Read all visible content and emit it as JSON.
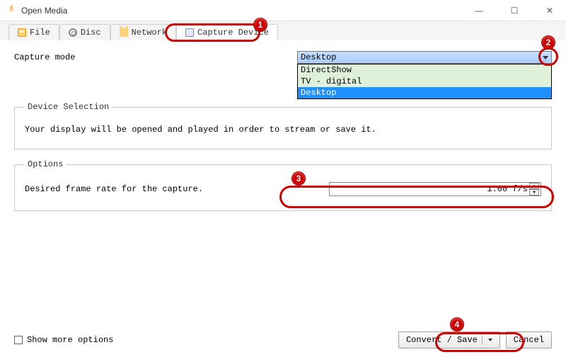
{
  "window": {
    "title": "Open Media",
    "min": "—",
    "max": "☐",
    "close": "✕"
  },
  "tabs": {
    "file": "File",
    "disc": "Disc",
    "network": "Network",
    "capture": "Capture Device"
  },
  "capture": {
    "mode_label": "Capture mode",
    "selected": "Desktop",
    "options": {
      "directshow": "DirectShow",
      "tvdigital": "TV - digital",
      "desktop": "Desktop"
    }
  },
  "device_selection": {
    "legend": "Device Selection",
    "text": "Your display will be opened and played in order to stream or save it."
  },
  "options": {
    "legend": "Options",
    "framerate_label": "Desired frame rate for the capture.",
    "framerate_value": "1.00 f/s"
  },
  "footer": {
    "show_more": "Show more options",
    "convert": "Convert / Save",
    "cancel": "Cancel"
  },
  "callouts": {
    "1": "1",
    "2": "2",
    "3": "3",
    "4": "4"
  }
}
